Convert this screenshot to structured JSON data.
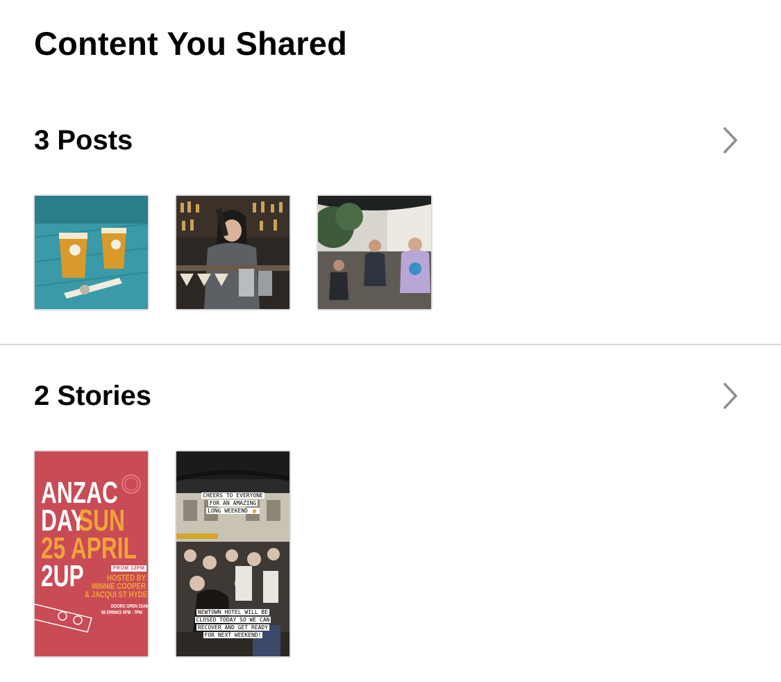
{
  "page": {
    "title": "Content You Shared"
  },
  "posts": {
    "header_label": "3 Posts",
    "count": 3
  },
  "stories": {
    "header_label": "2 Stories",
    "count": 2,
    "poster": {
      "line1": "ANZAC",
      "line2a": "DAY",
      "line2b": "SUN",
      "line3": "25 APRIL",
      "line4": "2UP",
      "from": "FROM 12PM",
      "hosted": [
        "HOSTED BY",
        "MINNIE COOPER",
        "& JACQUI ST HYDE"
      ],
      "doors": [
        "DOORS OPEN 10AM",
        "$6 DRINKS 5PM - 7PM"
      ]
    },
    "caption_top": [
      "CHEERS TO EVERYONE",
      "FOR AN AMAZING",
      "LONG WEEKEND 🍺"
    ],
    "caption_bottom": [
      "NEWTOWN HOTEL WILL BE",
      "CLOSED TODAY SO WE CAN",
      "RECOVER AND GET READY",
      "FOR NEXT WEEKEND!"
    ]
  },
  "icons": {
    "chevron": "chevron-right-icon"
  },
  "colors": {
    "divider": "#d7d7d7",
    "chevron": "#8e8e93",
    "thumb_border": "#dcdcdc",
    "poster_bg": "#c94b55",
    "poster_accent": "#f0a33a"
  }
}
